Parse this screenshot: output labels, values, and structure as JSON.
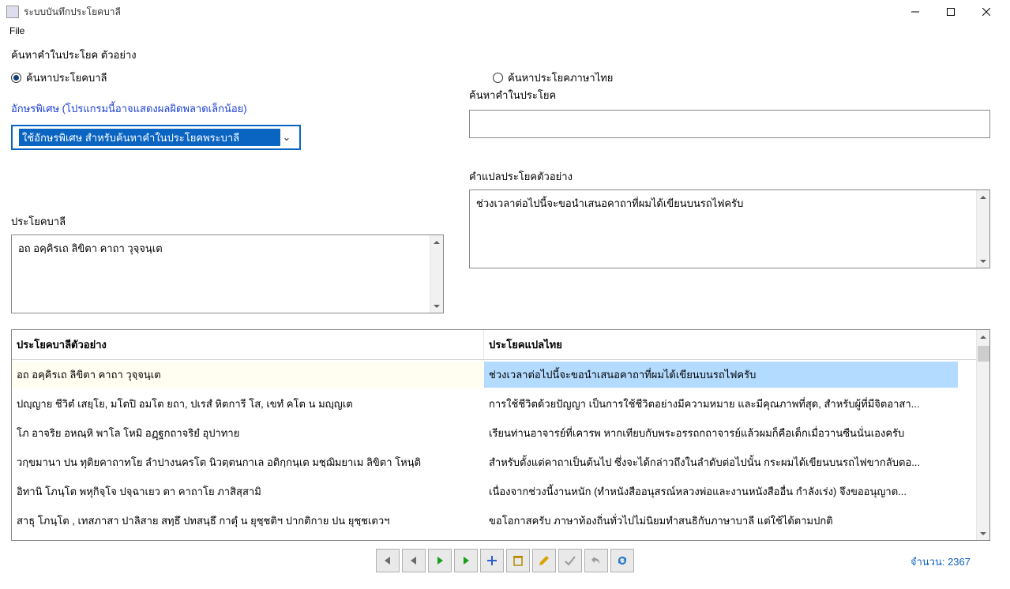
{
  "window": {
    "title": "ระบบบันทึกประโยคบาลี"
  },
  "menu": {
    "file": "File"
  },
  "labels": {
    "find_word_example": "ค้นหาคำในประโยค ตัวอย่าง",
    "radio_pali": "ค้นหาประโยคบาลี",
    "radio_thai": "ค้นหาประโยคภาษาไทย",
    "special_chars": "อักษรพิเศษ (โปรแกรมนี้อาจแสดงผลผิดพลาดเล็กน้อย)",
    "combo_placeholder": "ใช้อักษรพิเศษ สำหรับค้นหาคำในประโยคพระบาลี",
    "find_in_sentence": "ค้นหาคำในประโยค",
    "pali_sentence": "ประโยคบาลี",
    "translation_example": "คำแปลประโยคตัวอย่าง",
    "col_pali_example": "ประโยคบาลีตัวอย่าง",
    "col_thai_translation": "ประโยคแปลไทย",
    "count_label": "จำนวน: 2367"
  },
  "fields": {
    "pali_sentence_value": "อถ อคฺคิรเถ ลิขิตา คาถา วุจฺจนฺเต",
    "translation_value": "ช่วงเวลาต่อไปนี้จะขอนำเสนอคาถาที่ผมได้เขียนบนรถไฟครับ",
    "search_value": ""
  },
  "table_rows": [
    {
      "pali": "อถ อคฺคิรเถ ลิขิตา คาถา วุจฺจนฺเต",
      "thai": "ช่วงเวลาต่อไปนี้จะขอนำเสนอคาถาที่ผมได้เขียนบนรถไฟครับ"
    },
    {
      "pali": "ปญฺญาย ชีวิตํ เสยฺโย,  มโตปิ อมโต ยถา, ปเรสํ หิตการี โส, เขทํ คโต น มญฺญเต",
      "thai": "การใช้ชีวิตด้วยปัญญา เป็นการใช้ชีวิตอย่างมีความหมาย และมีคุณภาพที่สุด, สำหรับผู้ที่มีจิตอาสา..."
    },
    {
      "pali": "โภ อาจริย อหณฺหิ พาโล โหมิ อฏฺฐกถาจริยํ อุปาทาย",
      "thai": "เรียนท่านอาจารย์ที่เคารพ หากเทียบกับพระอรรถกถาจารย์แล้วผมก็คือเด็กเมื่อวานซืนนั่นเองครับ"
    },
    {
      "pali": "วกฺขมานา ปน ทุติยคาถาทโย  ลำปางนครโต นิวตฺตนกาเล อติกฺกนฺเต มชฺฌิมยาเม ลิขิตา โหนฺติ",
      "thai": "สำหรับตั้งแต่คาถาเป็นต้นไป ซึ่งจะได้กล่าวถึงในลำดับต่อไปนั้น กระผมได้เขียนบนรถไฟขากลับตอ..."
    },
    {
      "pali": "อิทานิ โภนฺโต พหุกิจฺโจ ปจฺฉาเยว ตา คาถาโย ภาสิสฺสามิ",
      "thai": "เนื่องจากช่วงนี้งานหนัก (ทำหนังสืออนุสรณ์หลวงพ่อและงานหนังสืออื่น กำลังเร่ง) จึงขออนุญาต..."
    },
    {
      "pali": "สาธุ โภนฺโต , เทสภาสา ปาลิสาย สทฺธึ  ปทสนฺธึ กาตุํ น ยุชฺชติฯ ปากติกาย ปน ยุชฺชเตวฯ",
      "thai": "ขอโอกาสครับ ภาษาท้องถิ่นทั่วไปไม่นิยมทำสนธิกับภาษาบาลี แต่ใช้ได้ตามปกติ"
    }
  ]
}
